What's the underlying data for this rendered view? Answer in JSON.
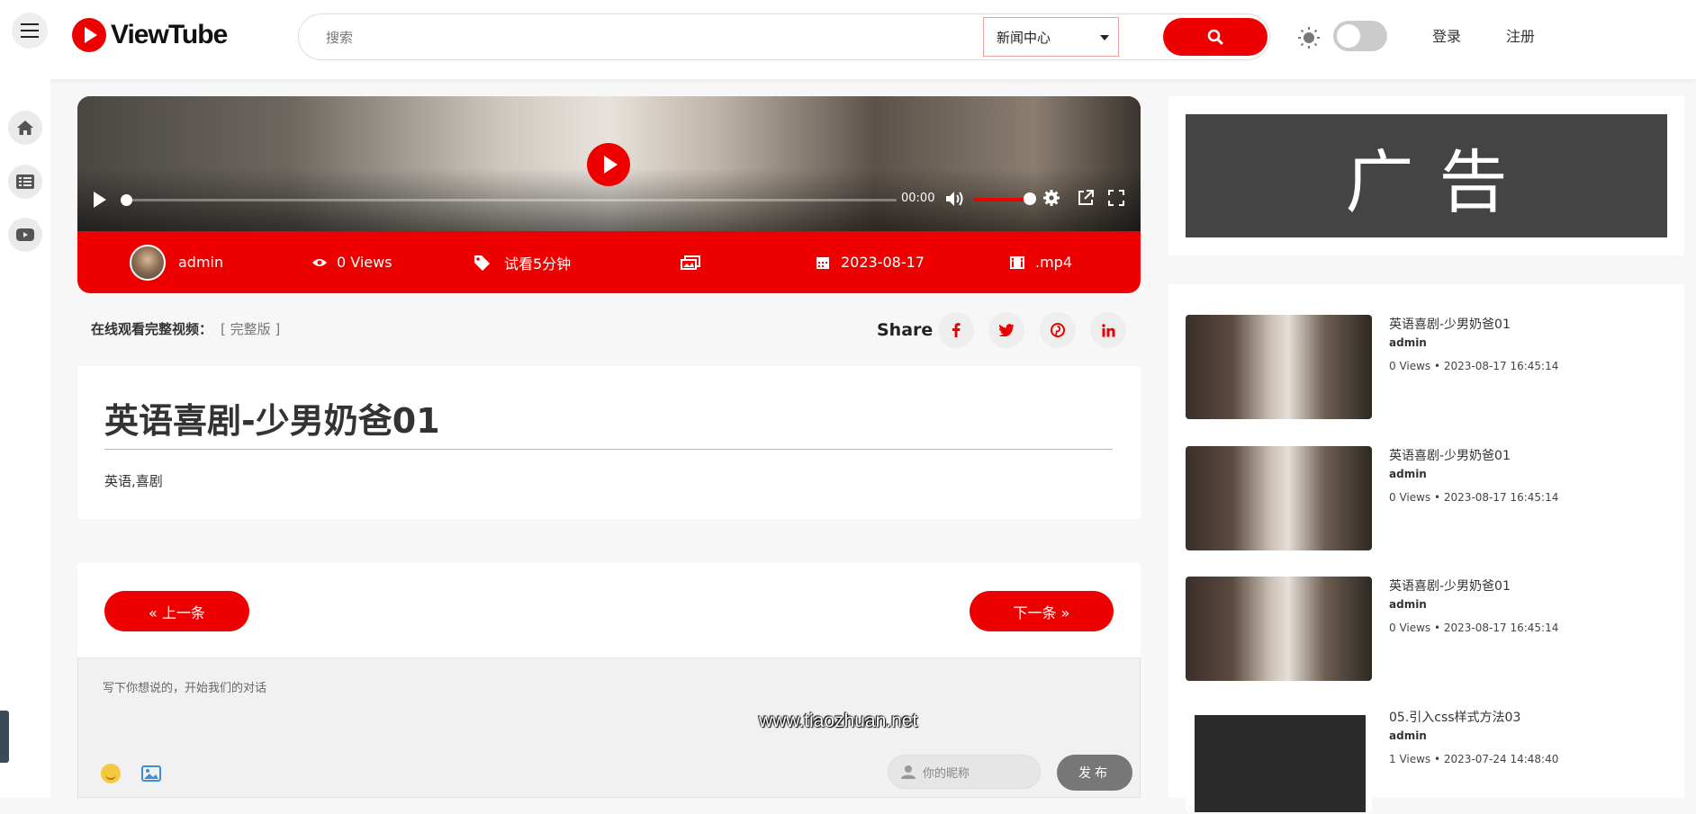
{
  "header": {
    "logo_text": "ViewTube",
    "search": {
      "placeholder": "搜索",
      "category": "新闻中心"
    },
    "login": "登录",
    "register": "注册"
  },
  "player": {
    "time": "00:00",
    "volume_level": 0.95,
    "progress": 0
  },
  "meta": {
    "author": "admin",
    "views": "0 Views",
    "trial": "试看5分钟",
    "date": "2023-08-17",
    "format": ".mp4"
  },
  "watch": {
    "label": "在线观看完整视频：",
    "link": "[ 完整版 ]"
  },
  "share": {
    "label": "Share"
  },
  "article": {
    "title": "英语喜剧-少男奶爸01",
    "tags": "英语,喜剧"
  },
  "pager": {
    "prev": "« 上一条",
    "next": "下一条 »"
  },
  "comment": {
    "placeholder": "写下你想说的，开始我们的对话",
    "watermark": "www.tiaozhuan.net",
    "nickname_placeholder": "你的昵称",
    "post": "发布"
  },
  "ad": {
    "text": "广告"
  },
  "related": [
    {
      "title": "英语喜剧-少男奶爸01",
      "author": "admin",
      "meta": "0 Views • 2023-08-17 16:45:14"
    },
    {
      "title": "英语喜剧-少男奶爸01",
      "author": "admin",
      "meta": "0 Views • 2023-08-17 16:45:14"
    },
    {
      "title": "英语喜剧-少男奶爸01",
      "author": "admin",
      "meta": "0 Views • 2023-08-17 16:45:14"
    },
    {
      "title": "05.引入css样式方法03",
      "author": "admin",
      "meta": "1 Views • 2023-07-24 14:48:40"
    }
  ],
  "colors": {
    "accent": "#ee0000",
    "dark": "#444444"
  }
}
